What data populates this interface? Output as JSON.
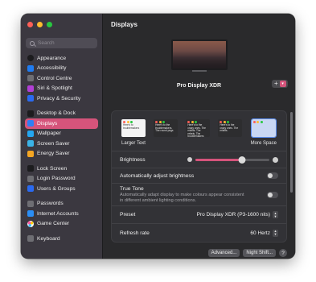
{
  "window": {
    "title": "Displays"
  },
  "search": {
    "placeholder": "Search"
  },
  "sidebar": {
    "groups": [
      [
        {
          "label": "Appearance",
          "icon": "appearance-icon",
          "color": "#1c1c1e"
        },
        {
          "label": "Accessibility",
          "icon": "accessibility-icon",
          "color": "#1f7cf2"
        },
        {
          "label": "Control Centre",
          "icon": "control-centre-icon",
          "color": "#6e6e73"
        },
        {
          "label": "Siri & Spotlight",
          "icon": "siri-icon",
          "color": "#b13fd6"
        },
        {
          "label": "Privacy & Security",
          "icon": "privacy-hand-icon",
          "color": "#2a6af1"
        }
      ],
      [
        {
          "label": "Desktop & Dock",
          "icon": "desktop-dock-icon",
          "color": "#1c1c1e"
        },
        {
          "label": "Displays",
          "icon": "displays-icon",
          "color": "#2f7ff5",
          "selected": true
        },
        {
          "label": "Wallpaper",
          "icon": "wallpaper-icon",
          "color": "#24a6f0"
        },
        {
          "label": "Screen Saver",
          "icon": "screen-saver-icon",
          "color": "#3bb3e6"
        },
        {
          "label": "Energy Saver",
          "icon": "energy-saver-icon",
          "color": "#f5a623"
        }
      ],
      [
        {
          "label": "Lock Screen",
          "icon": "lock-screen-icon",
          "color": "#1c1c1e"
        },
        {
          "label": "Login Password",
          "icon": "login-password-icon",
          "color": "#6e6e73"
        },
        {
          "label": "Users & Groups",
          "icon": "users-groups-icon",
          "color": "#2a6af1"
        }
      ],
      [
        {
          "label": "Passwords",
          "icon": "passwords-key-icon",
          "color": "#6e6e73"
        },
        {
          "label": "Internet Accounts",
          "icon": "internet-accounts-icon",
          "color": "#2a8ef5"
        },
        {
          "label": "Game Center",
          "icon": "game-center-icon",
          "color": "#ffffff"
        }
      ],
      [
        {
          "label": "Keyboard",
          "icon": "keyboard-icon",
          "color": "#6e6e73"
        }
      ]
    ]
  },
  "display": {
    "name": "Pro Display XDR",
    "add_label": "+"
  },
  "resolution": {
    "options": [
      {
        "label": "Larger Text",
        "sample": "Here's to troublemakers",
        "selected": false,
        "dark": false
      },
      {
        "label": "",
        "sample": "Here's to the troublemakers. The round pegs",
        "selected": false,
        "dark": false
      },
      {
        "label": "",
        "sample": "Here's to the crazy ones. The misfits. The rebels. The troublemakers",
        "selected": false,
        "dark": false
      },
      {
        "label": "",
        "sample": "Here's to the crazy ones. The misfits.",
        "selected": false,
        "dark": false
      },
      {
        "label": "More Space",
        "sample": "",
        "selected": true,
        "dark": false
      }
    ]
  },
  "brightness": {
    "label": "Brightness",
    "value": 0.63
  },
  "auto_brightness": {
    "label": "Automatically adjust brightness",
    "on": false
  },
  "true_tone": {
    "label": "True Tone",
    "description": "Automatically adapt display to make colours appear consistent in different ambient lighting conditions.",
    "on": false
  },
  "preset": {
    "label": "Preset",
    "value": "Pro Display XDR (P3-1600 nits)"
  },
  "refresh_rate": {
    "label": "Refresh rate",
    "value": "60 Hertz"
  },
  "footer": {
    "advanced_label": "Advanced...",
    "night_shift_label": "Night Shift...",
    "help_label": "?"
  },
  "colors": {
    "accent": "#d5547b"
  }
}
